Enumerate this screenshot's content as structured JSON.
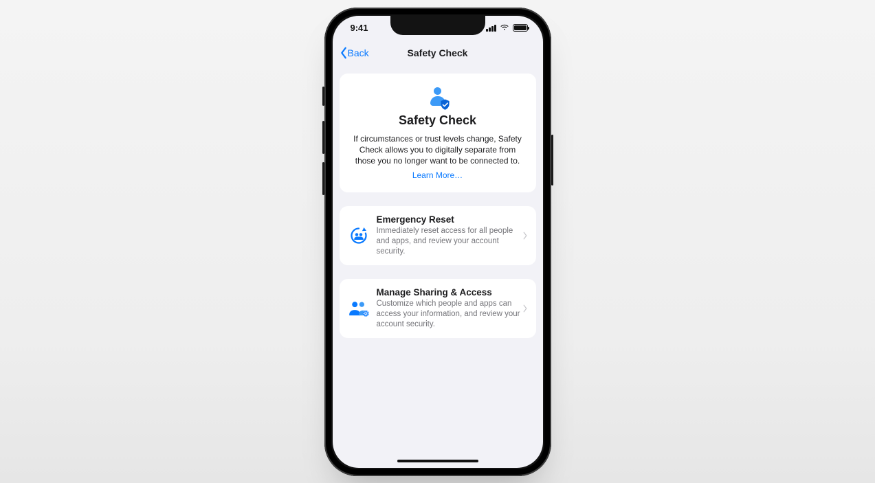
{
  "status": {
    "time": "9:41"
  },
  "nav": {
    "back_label": "Back",
    "title": "Safety Check"
  },
  "hero": {
    "title": "Safety Check",
    "body": "If circumstances or trust levels change, Safety Check allows you to digitally separate from those you no longer want to be connected to.",
    "learn_more": "Learn More…"
  },
  "rows": [
    {
      "title": "Emergency Reset",
      "subtitle": "Immediately reset access for all people and apps, and review your account security."
    },
    {
      "title": "Manage Sharing & Access",
      "subtitle": "Customize which people and apps can access your information, and review your account security."
    }
  ]
}
